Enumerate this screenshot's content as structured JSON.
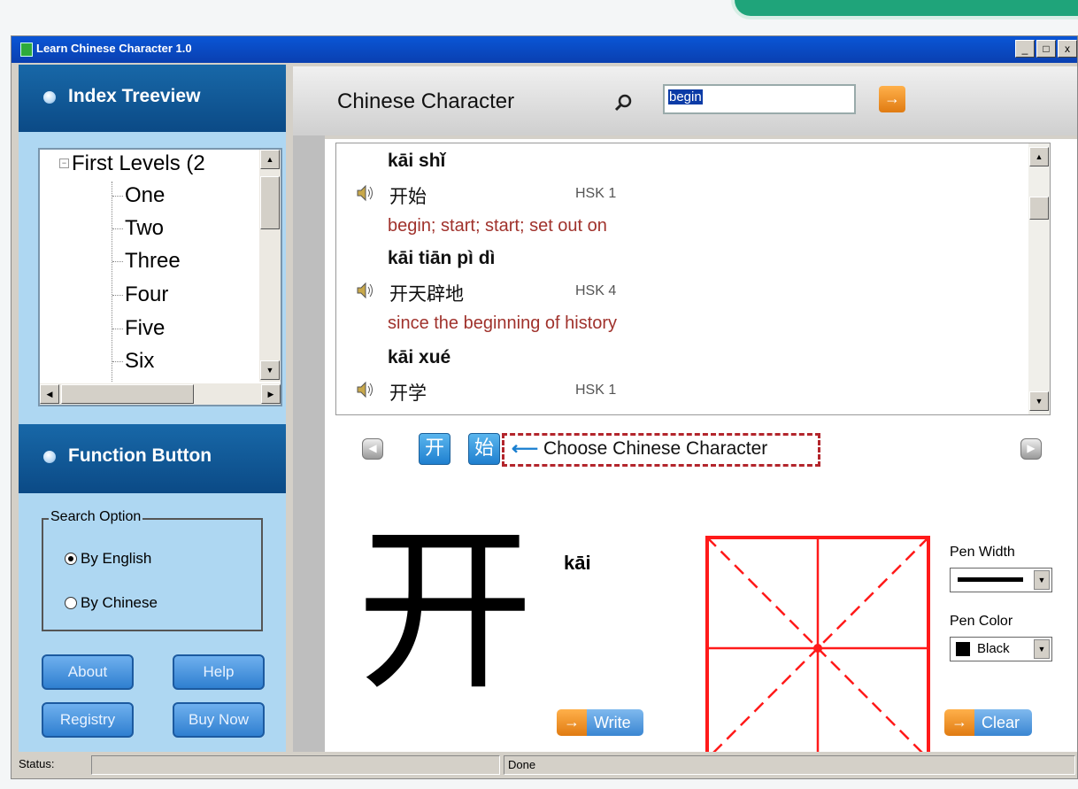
{
  "window": {
    "title": "Learn Chinese Character 1.0",
    "controls": {
      "minimize": "_",
      "maximize": "□",
      "close": "x"
    }
  },
  "sidebar": {
    "index_title": "Index Treeview",
    "tree": {
      "root": "First Levels (2",
      "items": [
        "One",
        "Two",
        "Three",
        "Four",
        "Five",
        "Six"
      ]
    },
    "function_title": "Function Button",
    "search_option": {
      "legend": "Search Option",
      "options": [
        "By English",
        "By Chinese"
      ],
      "selected": "By English"
    },
    "buttons": {
      "about": "About",
      "help": "Help",
      "registry": "Registry",
      "buy_now": "Buy Now"
    }
  },
  "header": {
    "title": "Chinese Character",
    "search_value": "begin",
    "search_icon": "magnifier-icon",
    "go_icon": "arrow-right-icon"
  },
  "results": [
    {
      "pinyin": "kāi shǐ",
      "chars": "开始",
      "hsk": "HSK 1",
      "definition": "begin; start; start; set out on"
    },
    {
      "pinyin": "kāi tiān pì dì",
      "chars": "开天辟地",
      "hsk": "HSK 4",
      "definition": "since the beginning of history"
    },
    {
      "pinyin": "kāi xué",
      "chars": "开学",
      "hsk": "HSK 1",
      "definition": ""
    }
  ],
  "char_chooser": {
    "chars": [
      "开",
      "始"
    ],
    "hint": "Choose Chinese Character"
  },
  "detail": {
    "character": "开",
    "pinyin": "kāi",
    "write_label": "Write",
    "clear_label": "Clear",
    "pen_width_label": "Pen Width",
    "pen_color_label": "Pen Color",
    "pen_color_value": "Black"
  },
  "status": {
    "label": "Status:",
    "message": "Done"
  },
  "colors": {
    "accent_blue": "#0b4a86",
    "panel_blue": "#aed7f2",
    "definition_red": "#a0322c",
    "grid_red": "#ff1a1a"
  }
}
